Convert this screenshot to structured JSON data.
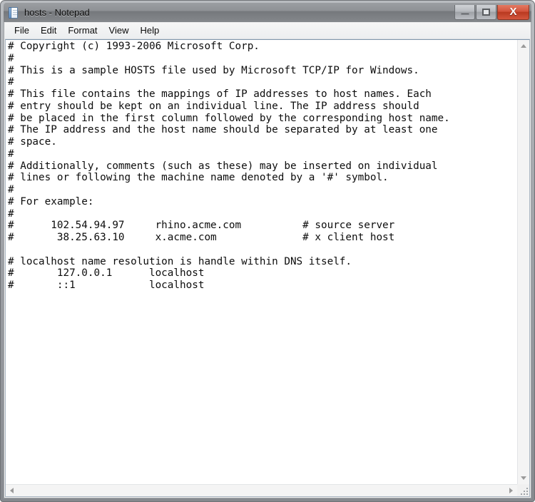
{
  "window": {
    "title": "hosts - Notepad",
    "app_icon": "notepad-icon",
    "buttons": {
      "minimize": "–",
      "maximize": "□",
      "close": "X"
    }
  },
  "menubar": {
    "items": [
      {
        "label": "File"
      },
      {
        "label": "Edit"
      },
      {
        "label": "Format"
      },
      {
        "label": "View"
      },
      {
        "label": "Help"
      }
    ]
  },
  "editor": {
    "content": "# Copyright (c) 1993-2006 Microsoft Corp.\n#\n# This is a sample HOSTS file used by Microsoft TCP/IP for Windows.\n#\n# This file contains the mappings of IP addresses to host names. Each\n# entry should be kept on an individual line. The IP address should\n# be placed in the first column followed by the corresponding host name.\n# The IP address and the host name should be separated by at least one\n# space.\n#\n# Additionally, comments (such as these) may be inserted on individual\n# lines or following the machine name denoted by a '#' symbol.\n#\n# For example:\n#\n#      102.54.94.97     rhino.acme.com          # source server\n#       38.25.63.10     x.acme.com              # x client host\n\n# localhost name resolution is handle within DNS itself.\n#       127.0.0.1      localhost\n#       ::1            localhost",
    "lines": [
      "# Copyright (c) 1993-2006 Microsoft Corp.",
      "#",
      "# This is a sample HOSTS file used by Microsoft TCP/IP for Windows.",
      "#",
      "# This file contains the mappings of IP addresses to host names. Each",
      "# entry should be kept on an individual line. The IP address should",
      "# be placed in the first column followed by the corresponding host name.",
      "# The IP address and the host name should be separated by at least one",
      "# space.",
      "#",
      "# Additionally, comments (such as these) may be inserted on individual",
      "# lines or following the machine name denoted by a '#' symbol.",
      "#",
      "# For example:",
      "#",
      "#      102.54.94.97     rhino.acme.com          # source server",
      "#       38.25.63.10     x.acme.com              # x client host",
      "",
      "# localhost name resolution is handle within DNS itself.",
      "#       127.0.0.1      localhost",
      "#       ::1            localhost"
    ]
  },
  "scrollbars": {
    "vertical": {
      "up_arrow": "scroll-up-arrow",
      "down_arrow": "scroll-down-arrow"
    },
    "horizontal": {
      "left_arrow": "scroll-left-arrow",
      "right_arrow": "scroll-right-arrow"
    },
    "resize_grip": "resize-grip"
  },
  "colors": {
    "titlebar_start": "#9b9ea2",
    "titlebar_end": "#85888c",
    "close_button": "#c8402a",
    "client_bg": "#f0f0f0",
    "text_bg": "#ffffff",
    "text_fg": "#0d0d0d"
  }
}
